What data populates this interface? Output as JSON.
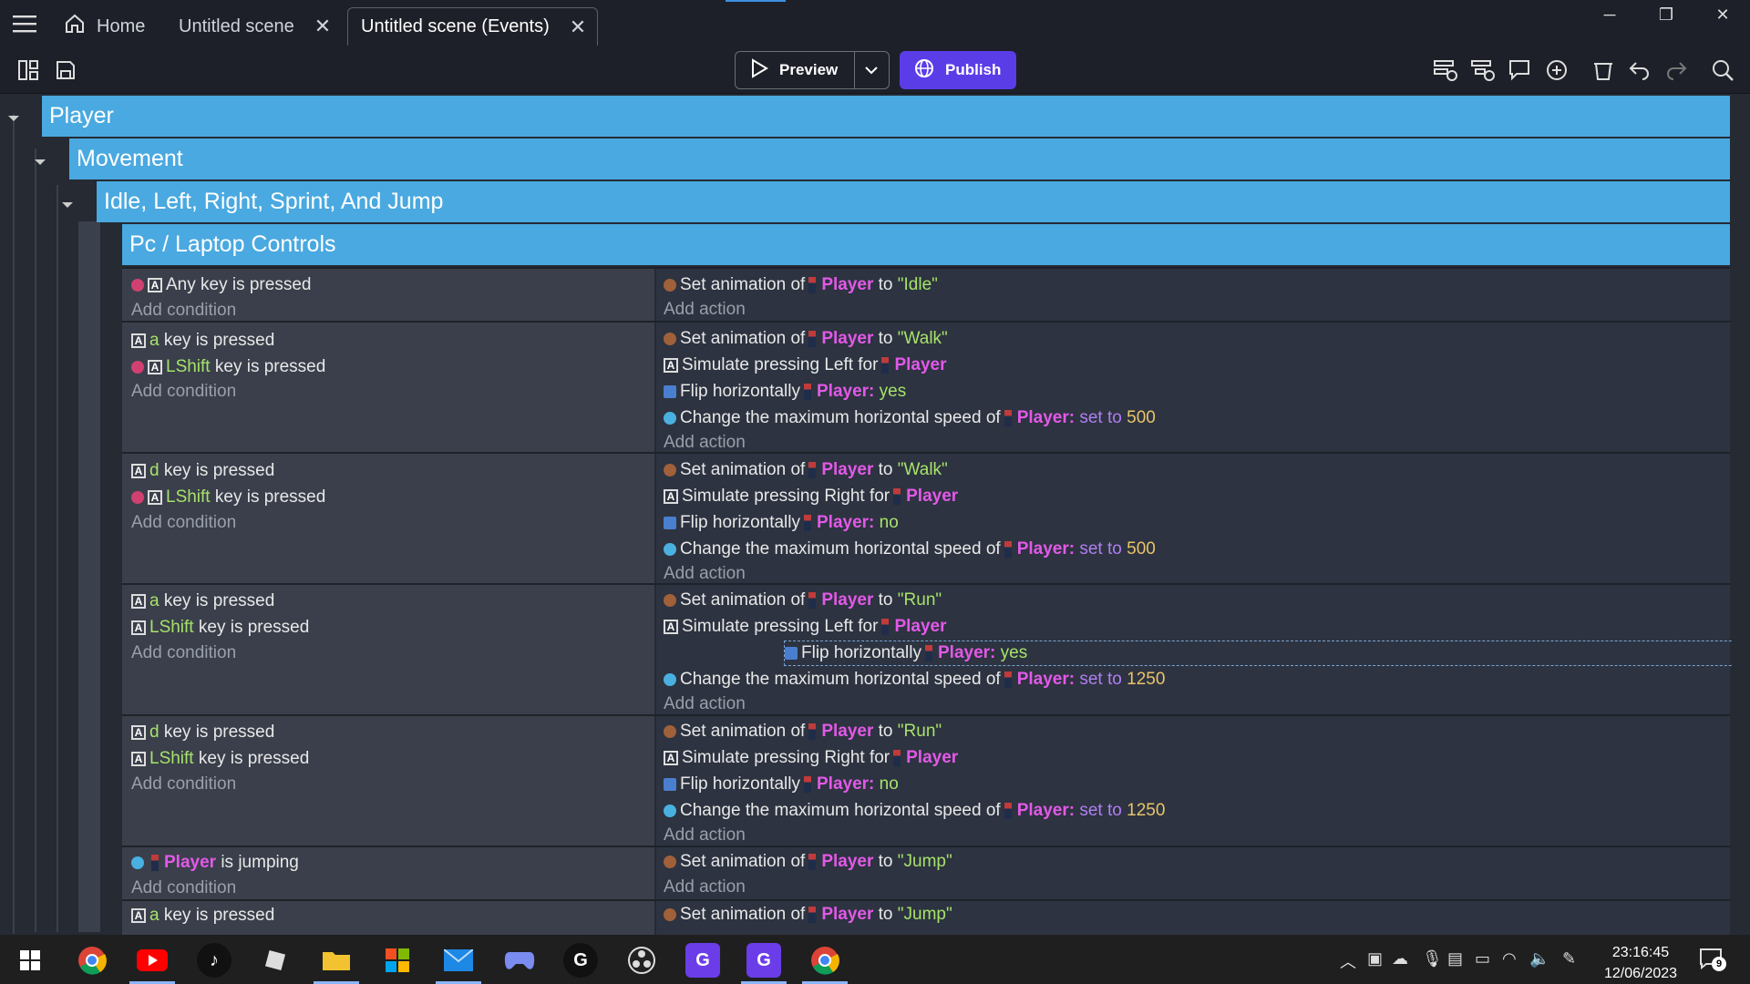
{
  "window": {
    "tabs": [
      {
        "label": "Home"
      },
      {
        "label": "Untitled scene"
      },
      {
        "label": "Untitled scene (Events)"
      }
    ],
    "min": "─",
    "max": "❐",
    "close": "✕"
  },
  "toolbar": {
    "preview_label": "Preview",
    "publish_label": "Publish"
  },
  "groups": {
    "g1": "Player",
    "g2": "Movement",
    "g3": "Idle, Left, Right, Sprint, And Jump",
    "g4": "Pc / Laptop Controls"
  },
  "events": {
    "add_condition": "Add condition",
    "add_action": "Add action",
    "player": "Player",
    "set_anim": "Set animation of",
    "to": "to",
    "any_key": "Any key is pressed",
    "key_a": "a",
    "key_d": "d",
    "key_lshift": "LShift",
    "key_is_pressed": "key is pressed",
    "simulate": "Simulate pressing",
    "left_for": "Left for",
    "right_for": "Right for",
    "flip": "Flip horizontally",
    "yes": "yes",
    "no": "no",
    "change_speed": "Change the maximum horizontal speed of",
    "set_to": "set to",
    "speed_500": "500",
    "speed_1250": "1250",
    "anim_idle": "\"Idle\"",
    "anim_walk": "\"Walk\"",
    "anim_run": "\"Run\"",
    "anim_jump": "\"Jump\"",
    "is_jumping": "is jumping",
    "colon": ":"
  },
  "taskbar": {
    "time": "23:16:45",
    "date": "12/06/2023",
    "notif_count": "9"
  }
}
